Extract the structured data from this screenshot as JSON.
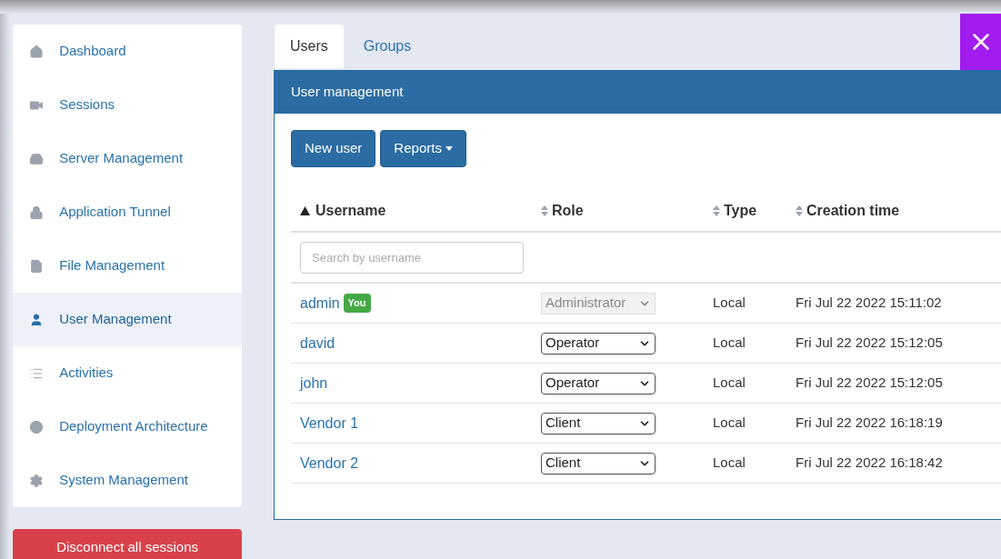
{
  "sidebar": {
    "items": [
      {
        "label": "Dashboard",
        "selected": false
      },
      {
        "label": "Sessions",
        "selected": false
      },
      {
        "label": "Server Management",
        "selected": false
      },
      {
        "label": "Application Tunnel",
        "selected": false
      },
      {
        "label": "File Management",
        "selected": false
      },
      {
        "label": "User Management",
        "selected": true
      },
      {
        "label": "Activities",
        "selected": false
      },
      {
        "label": "Deployment Architecture",
        "selected": false
      },
      {
        "label": "System Management",
        "selected": false
      }
    ],
    "disconnect_button": "Disconnect all sessions"
  },
  "tabs": [
    {
      "label": "Users",
      "selected": true
    },
    {
      "label": "Groups",
      "selected": false
    }
  ],
  "panel": {
    "title": "User management",
    "buttons": [
      {
        "label": "New user",
        "dropdown": false
      },
      {
        "label": "Reports",
        "dropdown": true
      }
    ],
    "table": {
      "columns": [
        {
          "label": "Username",
          "sorted": true
        },
        {
          "label": "Role",
          "sorted": false
        },
        {
          "label": "Type",
          "sorted": false
        },
        {
          "label": "Creation time",
          "sorted": false
        }
      ],
      "search": {
        "placeholder": "Search by username"
      },
      "rows": [
        {
          "username": "admin",
          "badge": "You",
          "role": "Administrator",
          "role_disabled": true,
          "type": "Local",
          "created": "Fri Jul 22 2022 15:11:02"
        },
        {
          "username": "david",
          "role": "Operator",
          "role_disabled": false,
          "type": "Local",
          "created": "Fri Jul 22 2022 15:12:05"
        },
        {
          "username": "john",
          "role": "Operator",
          "role_disabled": false,
          "type": "Local",
          "created": "Fri Jul 22 2022 15:12:05"
        },
        {
          "username": "Vendor 1",
          "role": "Client",
          "role_disabled": false,
          "type": "Local",
          "created": "Fri Jul 22 2022 16:18:19"
        },
        {
          "username": "Vendor 2",
          "role": "Client",
          "role_disabled": false,
          "type": "Local",
          "created": "Fri Jul 22 2022 16:18:42"
        }
      ]
    }
  }
}
